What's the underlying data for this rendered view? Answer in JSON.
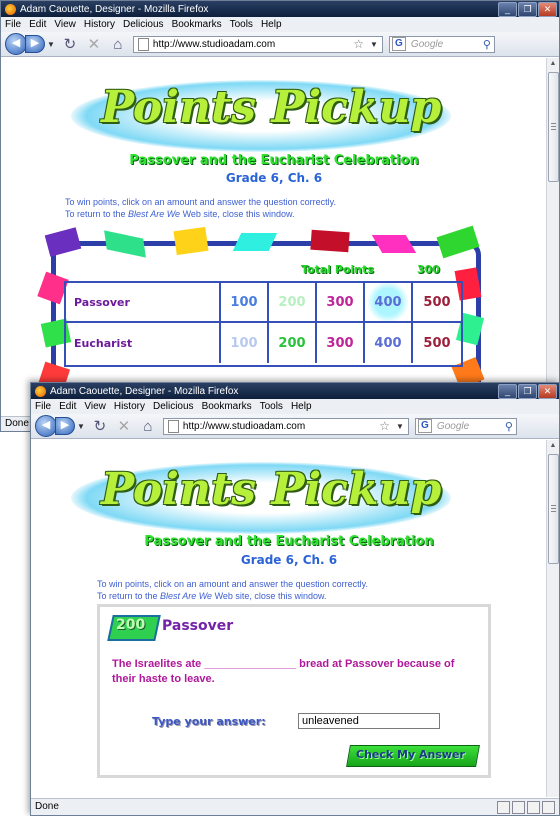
{
  "window_top": {
    "title": "Adam Caouette, Designer - Mozilla Firefox",
    "menu": [
      "File",
      "Edit",
      "View",
      "History",
      "Delicious",
      "Bookmarks",
      "Tools",
      "Help"
    ],
    "url": "http://www.studioadam.com",
    "search_placeholder": "Google",
    "status": "Done",
    "page": {
      "logo": "Points Pickup",
      "subtitle": "Passover and the Eucharist Celebration",
      "grade": "Grade 6, Ch. 6",
      "instruction_1": "To win points, click on an amount and answer the question correctly.",
      "instruction_2_pre": "To return to the ",
      "instruction_2_em": "Blest Are We",
      "instruction_2_post": " Web site, close this window.",
      "total_points_label": "Total Points",
      "total_points_value": "300",
      "rows": [
        {
          "category": "Passover",
          "points": [
            "100",
            "200",
            "300",
            "400",
            "500"
          ]
        },
        {
          "category": "Eucharist",
          "points": [
            "100",
            "200",
            "300",
            "400",
            "500"
          ]
        }
      ]
    }
  },
  "window_front": {
    "title": "Adam Caouette, Designer - Mozilla Firefox",
    "menu": [
      "File",
      "Edit",
      "View",
      "History",
      "Delicious",
      "Bookmarks",
      "Tools",
      "Help"
    ],
    "url": "http://www.studioadam.com",
    "search_placeholder": "Google",
    "status": "Done",
    "page": {
      "logo": "Points Pickup",
      "subtitle": "Passover and the Eucharist Celebration",
      "grade": "Grade 6, Ch. 6",
      "instruction_1": "To win points, click on an amount and answer the question correctly.",
      "instruction_2_pre": "To return to the ",
      "instruction_2_em": "Blest Are We",
      "instruction_2_post": " Web site, close this window.",
      "question": {
        "points": "200",
        "category": "Passover",
        "text": "The Israelites ate _______________ bread at Passover because of their haste to leave.",
        "answer_label": "Type your answer:",
        "answer_value": "unleavened",
        "submit_label": "Check My Answer"
      }
    }
  },
  "colors": {
    "point_colors": [
      "#4a7de0",
      "#7fe08a",
      "#c0239a",
      "#5a6ed6",
      "#9e1f3a"
    ],
    "chip_colors": [
      "#6b2fbf",
      "#2fe08a",
      "#ffd21a",
      "#2ff0e0",
      "#c40f2a",
      "#ff2fbf",
      "#2fd62f",
      "#ff7a1a",
      "#3050e0",
      "#ff4040"
    ]
  }
}
